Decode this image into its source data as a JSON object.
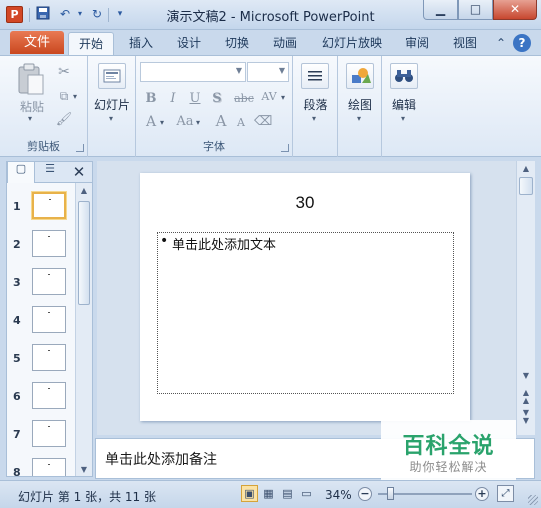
{
  "window": {
    "title": "演示文稿2  -  Microsoft PowerPoint",
    "app_icon_letter": "P",
    "controls": {
      "minimize": "▁",
      "maximize": "□",
      "close": "✕"
    }
  },
  "quick_access": {
    "save": "save-icon",
    "undo": "undo-icon",
    "redo": "redo-icon",
    "customize": "▾"
  },
  "ribbon_tabs": {
    "file": "文件",
    "items": [
      "开始",
      "插入",
      "设计",
      "切换",
      "动画",
      "幻灯片放映",
      "审阅",
      "视图"
    ],
    "active": "开始",
    "collapse_glyph": "⌃",
    "help_glyph": "?"
  },
  "ribbon": {
    "clipboard": {
      "paste": "粘贴",
      "group_label": "剪贴板"
    },
    "slides": {
      "slides_button": "幻灯片"
    },
    "font": {
      "group_label": "字体",
      "bold": "B",
      "italic": "I",
      "underline": "U",
      "shadow": "S",
      "strike": "abc",
      "spacing": "AV",
      "font_color": "A",
      "case": "Aa",
      "grow": "A",
      "shrink": "A"
    },
    "paragraph": {
      "label": "段落"
    },
    "drawing": {
      "label": "绘图"
    },
    "editing": {
      "label": "编辑"
    }
  },
  "slides_pane": {
    "thumbnails": [
      "1",
      "2",
      "3",
      "4",
      "5",
      "6",
      "7",
      "8"
    ],
    "selected": "1"
  },
  "slide": {
    "title": "30",
    "content_placeholder": "单击此处添加文本",
    "bullet": "•"
  },
  "notes": {
    "placeholder": "单击此处添加备注"
  },
  "watermark": {
    "title": "百科全说",
    "subtitle": "助你轻松解决"
  },
  "status_bar": {
    "slide_info": "幻灯片 第 1 张，共 11 张",
    "zoom": "34%",
    "zoom_level_percent": 34,
    "zoom_out": "−",
    "zoom_in": "+"
  },
  "colors": {
    "file_tab": "#d04f24",
    "ribbon_bg": "#dde8f5",
    "selected_thumb_border": "#e8b24a",
    "watermark_green": "#2aa36c"
  }
}
